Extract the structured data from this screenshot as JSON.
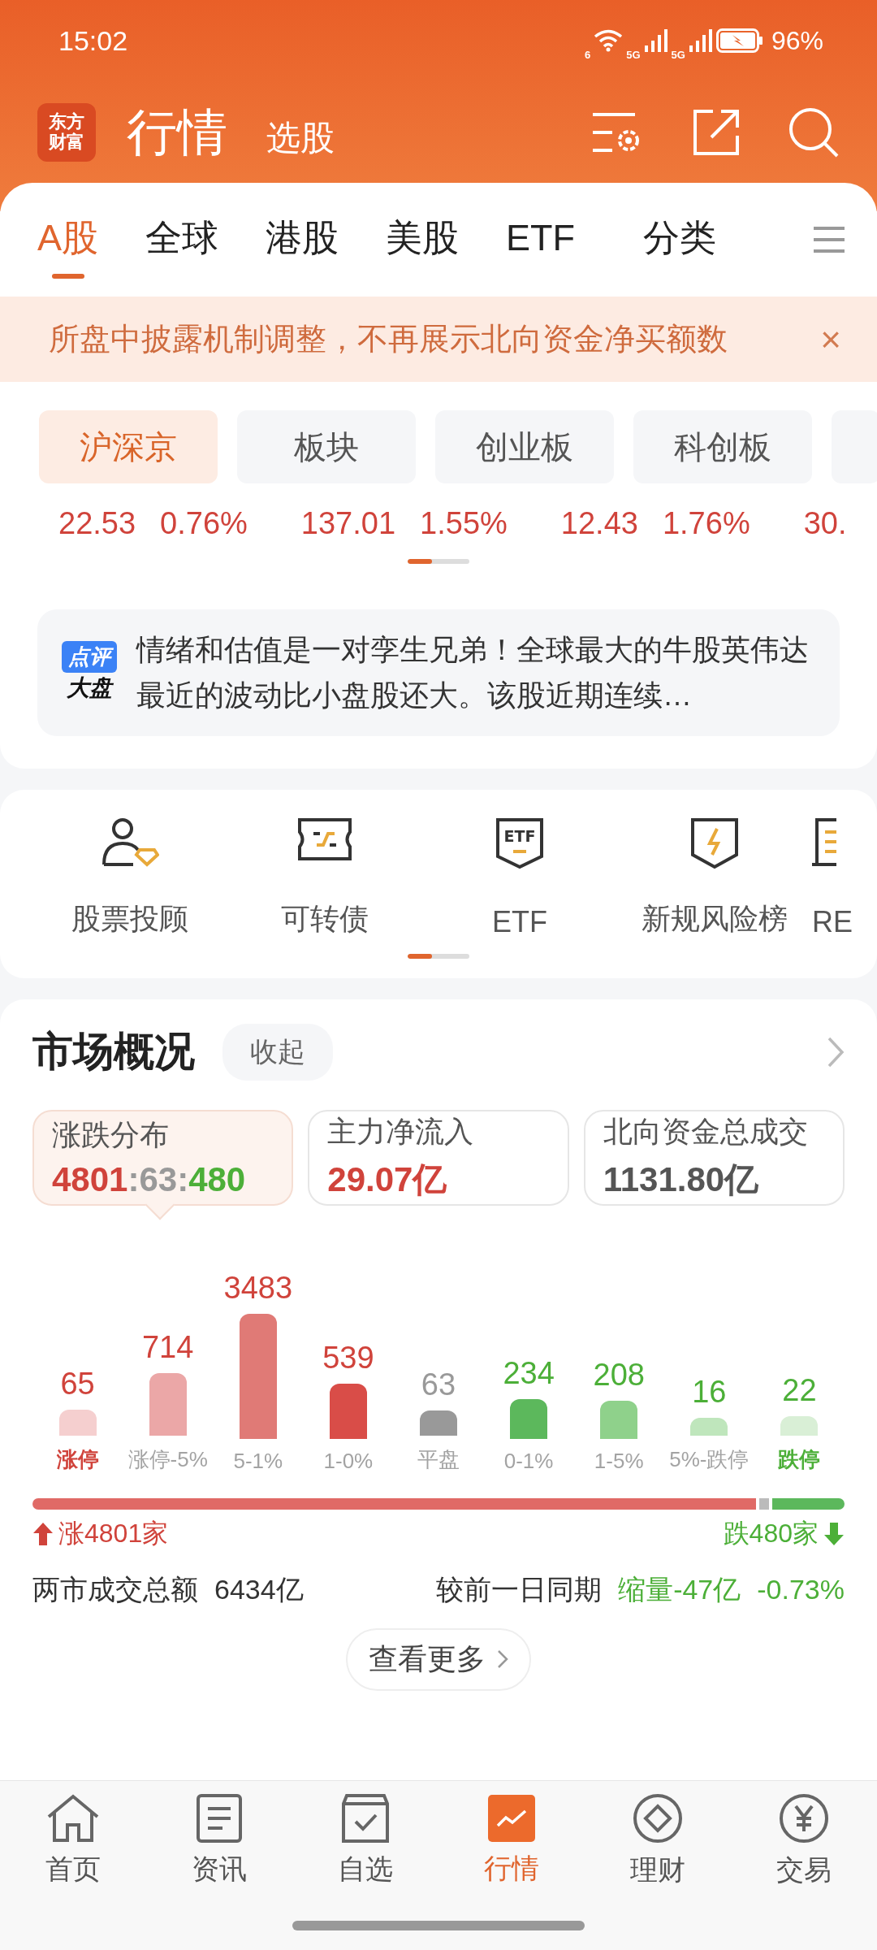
{
  "status_bar": {
    "time": "15:02",
    "wifi_label": "6",
    "sim_labels": [
      "5G",
      "5G"
    ],
    "battery": "96%"
  },
  "header": {
    "logo_lines": [
      "东方",
      "财富"
    ],
    "title": "行情",
    "subtitle": "选股"
  },
  "tabs": [
    {
      "label": "A股",
      "selected": true
    },
    {
      "label": "全球",
      "selected": false
    },
    {
      "label": "港股",
      "selected": false
    },
    {
      "label": "美股",
      "selected": false
    },
    {
      "label": "ETF",
      "selected": false
    },
    {
      "label": "分类",
      "selected": false
    }
  ],
  "notice": {
    "text": "所盘中披露机制调整，不再展示北向资金净买额数",
    "close": "×"
  },
  "index_chips": [
    {
      "label": "沪深京",
      "selected": true
    },
    {
      "label": "板块",
      "selected": false
    },
    {
      "label": "创业板",
      "selected": false
    },
    {
      "label": "科创板",
      "selected": false
    }
  ],
  "index_values": [
    {
      "price": "22.53",
      "change": "0.76%"
    },
    {
      "price": "137.01",
      "change": "1.55%"
    },
    {
      "price": "12.43",
      "change": "1.76%"
    },
    {
      "price": "30."
    }
  ],
  "commentary": {
    "badge_top": "点评",
    "badge_bottom": "大盘",
    "text": "情绪和估值是一对孪生兄弟！全球最大的牛股英伟达最近的波动比小盘股还大。该股近期连续…"
  },
  "shortcuts": [
    {
      "label": "股票投顾",
      "kind": "advisor"
    },
    {
      "label": "可转债",
      "kind": "bond"
    },
    {
      "label": "ETF",
      "kind": "etf",
      "icon_text": "ETF"
    },
    {
      "label": "新规风险榜",
      "kind": "risk"
    },
    {
      "label": "RE",
      "kind": "doc"
    }
  ],
  "market": {
    "title": "市场概况",
    "collapse": "收起",
    "stats": [
      {
        "label": "涨跌分布",
        "selected": true,
        "value_parts": [
          {
            "text": "4801",
            "kind": "up"
          },
          {
            "text": ":63:",
            "kind": "flat"
          },
          {
            "text": "480",
            "kind": "down"
          }
        ]
      },
      {
        "label": "主力净流入",
        "selected": false,
        "value_parts": [
          {
            "text": "29.07亿",
            "kind": "up"
          }
        ]
      },
      {
        "label": "北向资金总成交",
        "selected": false,
        "value_parts": [
          {
            "text": "1131.80亿",
            "kind": "dark"
          }
        ]
      }
    ],
    "distribution": [
      {
        "count": "65",
        "label": "涨停",
        "kind": "up",
        "emphasized": true,
        "color": "#f5cfcf"
      },
      {
        "count": "714",
        "label": "涨停-5%",
        "kind": "up",
        "emphasized": false,
        "color": "#eba7a7"
      },
      {
        "count": "3483",
        "label": "5-1%",
        "kind": "up",
        "emphasized": false,
        "color": "#e07a76"
      },
      {
        "count": "539",
        "label": "1-0%",
        "kind": "up",
        "emphasized": false,
        "color": "#d94d48"
      },
      {
        "count": "63",
        "label": "平盘",
        "kind": "flat",
        "emphasized": false,
        "color": "#999999"
      },
      {
        "count": "234",
        "label": "0-1%",
        "kind": "down",
        "emphasized": false,
        "color": "#5cb85c"
      },
      {
        "count": "208",
        "label": "1-5%",
        "kind": "down",
        "emphasized": false,
        "color": "#8fd18b"
      },
      {
        "count": "16",
        "label": "5%-跌停",
        "kind": "down",
        "emphasized": false,
        "color": "#bfe6bc"
      },
      {
        "count": "22",
        "label": "跌停",
        "kind": "down",
        "emphasized": true,
        "color": "#d9efd6"
      }
    ],
    "rise_label": "涨4801家",
    "fall_label": "跌480家",
    "turnover_label": "两市成交总额",
    "turnover_value": "6434亿",
    "compare_label": "较前一日同期",
    "compare_change": "缩量-47亿",
    "compare_pct": "-0.73%",
    "more_button": "查看更多"
  },
  "bottom_nav": [
    {
      "label": "首页",
      "kind": "home",
      "selected": false
    },
    {
      "label": "资讯",
      "kind": "news",
      "selected": false
    },
    {
      "label": "自选",
      "kind": "watch",
      "selected": false
    },
    {
      "label": "行情",
      "kind": "market",
      "selected": true
    },
    {
      "label": "理财",
      "kind": "wealth",
      "selected": false
    },
    {
      "label": "交易",
      "kind": "trade",
      "selected": false
    }
  ]
}
